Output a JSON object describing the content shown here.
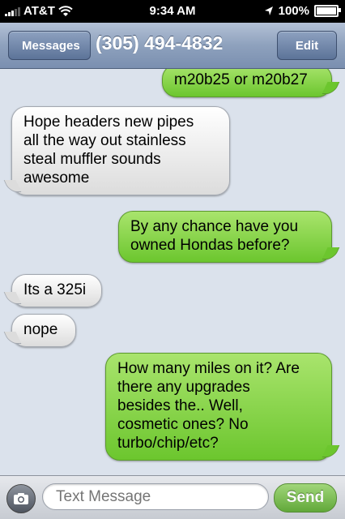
{
  "status_bar": {
    "carrier": "AT&T",
    "time": "9:34 AM",
    "battery": "100%",
    "icons": [
      "signal-icon",
      "wifi-icon",
      "location-arrow-icon",
      "battery-icon"
    ]
  },
  "nav": {
    "back_label": "Messages",
    "title": "(305) 494-4832",
    "edit_label": "Edit"
  },
  "messages": [
    {
      "direction": "sent",
      "lines": [
        "m20b25 or m20b27"
      ]
    },
    {
      "direction": "received",
      "lines": [
        "Hope headers new pipes",
        "all the way out stainless",
        "steal muffler sounds",
        "awesome"
      ]
    },
    {
      "direction": "sent",
      "lines": [
        "By any chance have you",
        "owned Hondas before?"
      ]
    },
    {
      "direction": "received",
      "lines": [
        "Its a 325i"
      ]
    },
    {
      "direction": "received",
      "lines": [
        "nope"
      ]
    },
    {
      "direction": "sent",
      "lines": [
        "How many miles on it? Are",
        "there any upgrades",
        "besides the.. Well,",
        "cosmetic ones? No",
        "turbo/chip/etc?"
      ]
    }
  ],
  "input": {
    "placeholder": "Text Message",
    "send_label": "Send"
  },
  "colors": {
    "sent_bubble": "#6cc62e",
    "received_bubble": "#e8e8e8",
    "background": "#dbe2ec",
    "nav_bar": "#8ea1bd"
  }
}
